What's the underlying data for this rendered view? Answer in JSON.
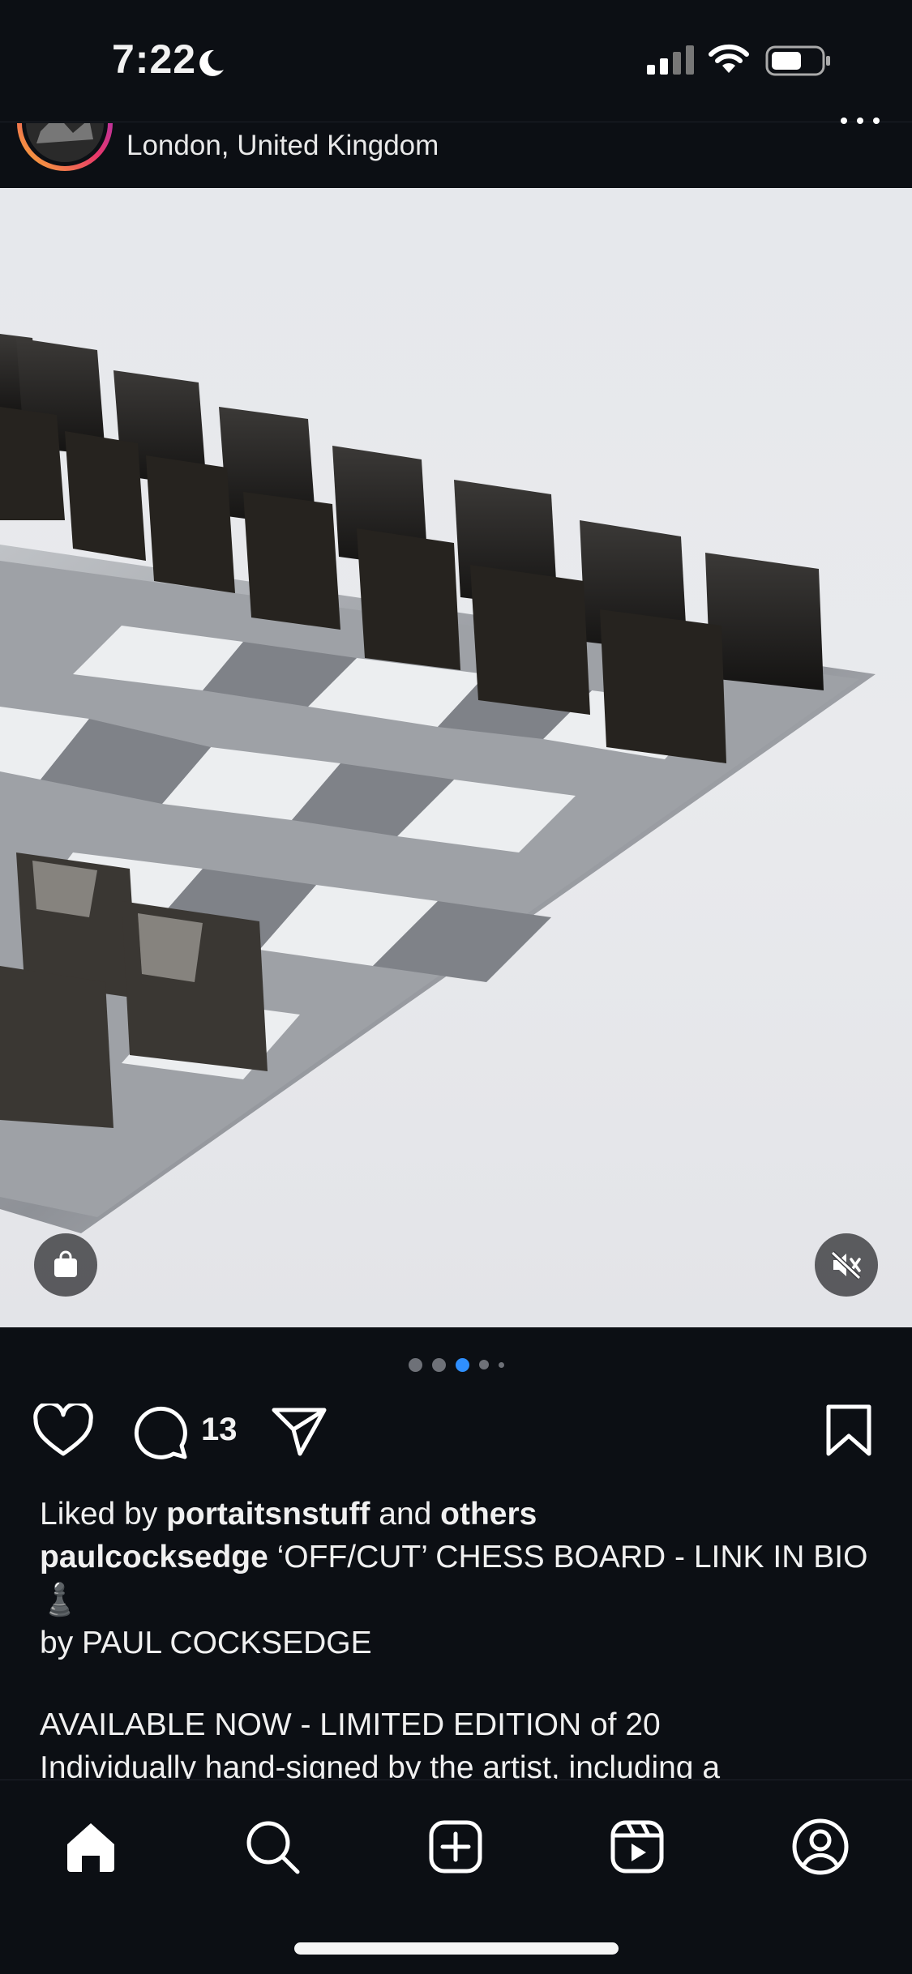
{
  "status": {
    "time": "7:22"
  },
  "post": {
    "location": "London, United Kingdom",
    "comment_count": "13",
    "liked_prefix": "Liked by ",
    "liked_user": "portaitsnstuff",
    "liked_and": " and ",
    "liked_others": "others",
    "author": "paulcocksedge",
    "caption_line1": " ‘OFF/CUT’ CHESS BOARD - LINK IN BIO ♟️",
    "caption_line2": "by PAUL COCKSEDGE",
    "caption_line3": "AVAILABLE NOW - LIMITED EDITION of 20",
    "caption_line4": "Individually hand-signed by the artist, including a"
  },
  "carousel": {
    "count": 5,
    "active_index": 2
  },
  "icons": {
    "shop": "shopping-bag-icon",
    "mute": "sound-off-icon",
    "like": "heart-icon",
    "comment": "comment-icon",
    "share": "send-icon",
    "save": "bookmark-icon"
  },
  "tabs": [
    "home",
    "search",
    "create",
    "reels",
    "profile"
  ],
  "colors": {
    "accent": "#2f8fff",
    "background": "#0c0f14"
  }
}
